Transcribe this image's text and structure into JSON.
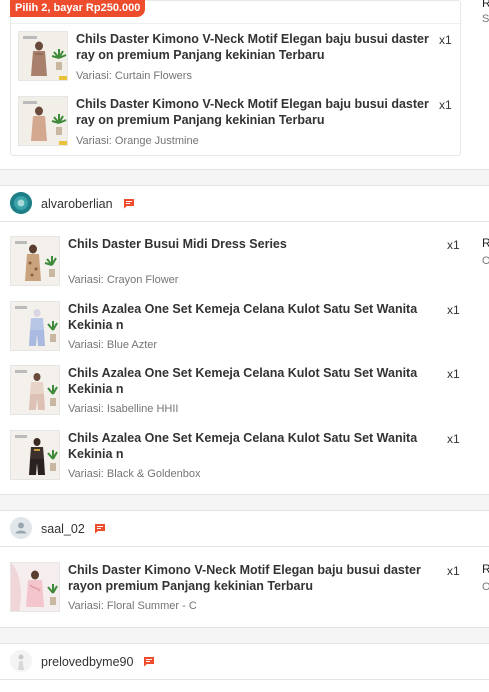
{
  "bundle": {
    "badge": "Pilih 2, bayar Rp250.000",
    "items": [
      {
        "name": "Chils Daster Kimono V-Neck Motif Elegan baju busui daster ray on premium Panjang kekinian Terbaru",
        "variation": "Variasi: Curtain Flowers",
        "qty": "x1"
      },
      {
        "name": "Chils Daster Kimono V-Neck Motif Elegan baju busui daster ray on premium Panjang kekinian Terbaru",
        "variation": "Variasi: Orange Justmine",
        "qty": "x1"
      }
    ]
  },
  "top_right": {
    "r1": "R",
    "r2": "S"
  },
  "orders": [
    {
      "shop": "alvaroberlian",
      "right_r1": "R",
      "right_r2": "O",
      "items": [
        {
          "name": "Chils Daster Busui Midi Dress Series",
          "variation": "Variasi: Crayon Flower",
          "qty": "x1"
        },
        {
          "name": "Chils Azalea One Set Kemeja Celana Kulot Satu Set Wanita Kekinia n",
          "variation": "Variasi: Blue Azter",
          "qty": "x1"
        },
        {
          "name": "Chils Azalea One Set Kemeja Celana Kulot Satu Set Wanita Kekinia n",
          "variation": "Variasi: Isabelline HHII",
          "qty": "x1"
        },
        {
          "name": "Chils Azalea One Set Kemeja Celana Kulot Satu Set Wanita Kekinia n",
          "variation": "Variasi: Black & Goldenbox",
          "qty": "x1"
        }
      ]
    },
    {
      "shop": "saal_02",
      "right_r1": "R",
      "right_r2": "O",
      "items": [
        {
          "name": "Chils Daster Kimono V-Neck Motif Elegan baju busui daster rayon premium Panjang kekinian Terbaru",
          "variation": "Variasi: Floral Summer - C",
          "qty": "x1"
        }
      ]
    },
    {
      "shop": "prelovedbyme90",
      "items": []
    }
  ],
  "colors": {
    "accent": "#ee4d2d",
    "avatar_teal": "#1e7f86",
    "avatar_grey": "#e0e6ea"
  },
  "icons": {
    "chat": "chat-bubble-icon",
    "user": "user-icon"
  }
}
